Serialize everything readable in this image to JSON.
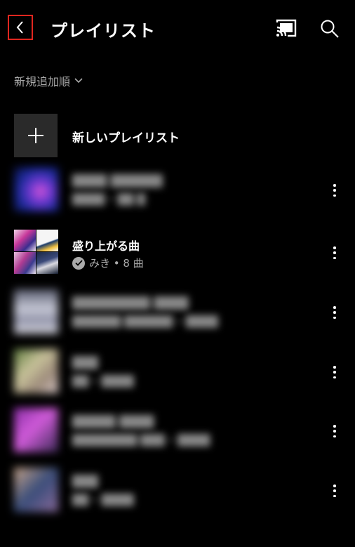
{
  "header": {
    "title": "プレイリスト",
    "back_icon": "chevron-left-icon",
    "cast_icon": "cast-icon",
    "search_icon": "search-icon"
  },
  "sort": {
    "label": "新規追加順",
    "icon": "chevron-down-icon"
  },
  "new_playlist": {
    "label": "新しいプレイリスト",
    "icon": "plus-icon"
  },
  "playlists": [
    {
      "title": "",
      "subtitle": "",
      "blurred": true,
      "colors": [
        "#1b2b9c",
        "#7c3bd6",
        "#e05bd0"
      ]
    },
    {
      "title": "盛り上がる曲",
      "subtitle": "みき • 8 曲",
      "blurred": false,
      "verified_icon": "check-circle-icon"
    },
    {
      "title": "",
      "subtitle": "",
      "blurred": true,
      "colors": [
        "#5a5d70",
        "#c9cbd8",
        "#8e90a6"
      ]
    },
    {
      "title": "",
      "subtitle": "",
      "blurred": true,
      "colors": [
        "#5c7a3c",
        "#c8c29a",
        "#9c8a7a"
      ]
    },
    {
      "title": "",
      "subtitle": "",
      "blurred": true,
      "colors": [
        "#8a2ea6",
        "#d05bd9",
        "#3b2a56"
      ]
    },
    {
      "title": "",
      "subtitle": "",
      "blurred": true,
      "colors": [
        "#caa68a",
        "#3a4d7a",
        "#8a6a9a"
      ]
    }
  ],
  "more_icon": "more-vertical-icon",
  "accent_colors": {
    "highlight": "#e0261f",
    "background": "#000000",
    "muted_text": "#aaaaaa"
  }
}
